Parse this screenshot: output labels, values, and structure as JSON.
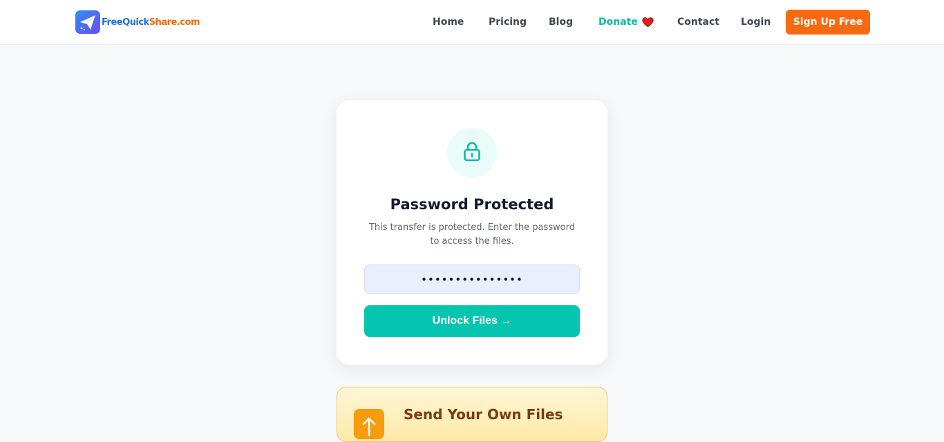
{
  "brand": {
    "name_part1": "FreeQuick",
    "name_part2": "Share.com",
    "colors": {
      "blue": "#1f6fe0",
      "orange": "#f26a0a"
    }
  },
  "nav": {
    "home": "Home",
    "pricing": "Pricing",
    "blog": "Blog",
    "donate": "Donate",
    "contact": "Contact",
    "login": "Login",
    "signup": "Sign Up Free"
  },
  "card": {
    "icon": "lock-icon",
    "title": "Password Protected",
    "description": "This transfer is protected. Enter the password to access the files.",
    "password_value": "•••••••••••••••",
    "unlock_label": "Unlock Files →"
  },
  "promo": {
    "title": "Send Your Own Files"
  },
  "colors": {
    "accent": "#05c4b0",
    "cta": "#f86a12",
    "background": "#f7f8fa"
  }
}
